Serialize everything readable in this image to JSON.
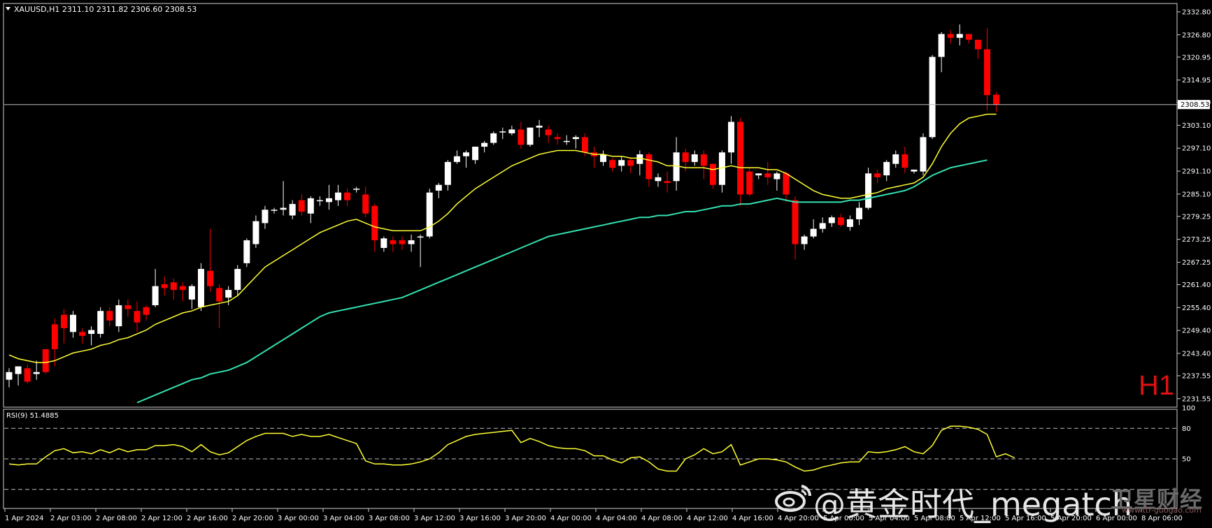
{
  "header": {
    "symbol_line": "XAUUSD,H1  2311.10 2311.82 2306.60 2308.53"
  },
  "timeframe_label": "H1",
  "rsi_header": "RSI(9) 51.4885",
  "current_price_tag": "2308.53",
  "watermark": {
    "text": "@黄金时代_megatch",
    "logo_icon": "weibo-logo-icon",
    "secondary_text": "卫星财经",
    "secondary_sub": "www.ttr-guogao.com"
  },
  "colors": {
    "background": "#000000",
    "bull_candle": "#ffffff",
    "bear_candle": "#ff0000",
    "ma_fast": "#ffff33",
    "ma_slow": "#33e0b0",
    "rsi_line": "#ffff33",
    "timeframe_label": "#dd1111"
  },
  "chart_data": {
    "type": "candlestick",
    "symbol": "XAUUSD",
    "timeframe": "H1",
    "ohlc_header": {
      "open": 2311.1,
      "high": 2311.82,
      "low": 2306.6,
      "close": 2308.53
    },
    "ylim": [
      2229.5,
      2334.8
    ],
    "y_ticks": [
      "2332.80",
      "2326.80",
      "2320.95",
      "2314.95",
      "2309.10",
      "2303.10",
      "2297.10",
      "2291.10",
      "2285.10",
      "2279.25",
      "2273.25",
      "2267.25",
      "2261.40",
      "2255.40",
      "2249.40",
      "2243.40",
      "2237.55",
      "2231.55"
    ],
    "x_tick_labels": [
      "1 Apr 2024",
      "2 Apr 03:00",
      "2 Apr 08:00",
      "2 Apr 12:00",
      "2 Apr 16:00",
      "2 Apr 20:00",
      "3 Apr 00:00",
      "3 Apr 04:00",
      "3 Apr 08:00",
      "3 Apr 12:00",
      "3 Apr 16:00",
      "3 Apr 20:00",
      "4 Apr 00:00",
      "4 Apr 04:00",
      "4 Apr 08:00",
      "4 Apr 12:00",
      "4 Apr 16:00",
      "4 Apr 20:00",
      "5 Apr 00:00",
      "5 Apr 04:00",
      "5 Apr 08:00",
      "5 Apr 12:00",
      "5 Apr 16:00",
      "5 Apr 20:00",
      "6 Apr 00:00",
      "8 Apr 06:00"
    ],
    "candles": [
      [
        2236.5,
        2238.5,
        2234.5,
        2239.5
      ],
      [
        2238.0,
        2240.0,
        2235.0,
        2240.0
      ],
      [
        2239.5,
        2236.0,
        2235.5,
        2240.5
      ],
      [
        2238.0,
        2238.5,
        2236.5,
        2241.5
      ],
      [
        2244.5,
        2238.5,
        2238.0,
        2244.5
      ],
      [
        2251.0,
        2244.5,
        2240.0,
        2252.5
      ],
      [
        2253.5,
        2250.0,
        2246.0,
        2255.0
      ],
      [
        2249.0,
        2253.5,
        2247.5,
        2254.5
      ],
      [
        2249.0,
        2248.0,
        2246.0,
        2250.0
      ],
      [
        2248.5,
        2249.5,
        2245.5,
        2250.5
      ],
      [
        2248.5,
        2254.5,
        2247.5,
        2255.5
      ],
      [
        2254.5,
        2252.0,
        2250.5,
        2255.5
      ],
      [
        2250.5,
        2256.0,
        2249.0,
        2257.5
      ],
      [
        2256.0,
        2255.0,
        2253.0,
        2257.5
      ],
      [
        2254.5,
        2251.5,
        2249.0,
        2257.0
      ],
      [
        2255.5,
        2253.5,
        2252.0,
        2256.0
      ],
      [
        2256.0,
        2261.0,
        2255.5,
        2265.5
      ],
      [
        2261.5,
        2260.5,
        2258.5,
        2263.5
      ],
      [
        2262.0,
        2260.0,
        2257.5,
        2263.0
      ],
      [
        2261.0,
        2260.0,
        2257.0,
        2262.0
      ],
      [
        2257.5,
        2261.0,
        2255.0,
        2261.5
      ],
      [
        2255.5,
        2265.5,
        2254.5,
        2267.0
      ],
      [
        2265.0,
        2261.0,
        2259.5,
        2276.0
      ],
      [
        2260.5,
        2257.0,
        2250.0,
        2261.5
      ],
      [
        2258.0,
        2260.0,
        2256.0,
        2261.0
      ],
      [
        2260.0,
        2265.5,
        2258.5,
        2266.5
      ],
      [
        2267.0,
        2273.0,
        2266.0,
        2273.5
      ],
      [
        2272.0,
        2278.0,
        2271.0,
        2279.5
      ],
      [
        2277.5,
        2281.0,
        2276.0,
        2282.0
      ],
      [
        2281.0,
        2281.0,
        2280.0,
        2281.5
      ],
      [
        2281.0,
        2281.5,
        2279.5,
        2288.5
      ],
      [
        2279.5,
        2282.5,
        2278.5,
        2283.5
      ],
      [
        2283.5,
        2280.5,
        2279.5,
        2285.0
      ],
      [
        2280.0,
        2284.0,
        2277.5,
        2284.5
      ],
      [
        2283.5,
        2283.5,
        2282.0,
        2284.5
      ],
      [
        2283.0,
        2284.0,
        2281.0,
        2287.5
      ],
      [
        2283.5,
        2285.5,
        2282.0,
        2287.5
      ],
      [
        2285.5,
        2283.5,
        2282.0,
        2286.5
      ],
      [
        2286.5,
        2286.5,
        2285.5,
        2287.0
      ],
      [
        2285.0,
        2280.0,
        2279.0,
        2287.0
      ],
      [
        2282.0,
        2273.0,
        2270.0,
        2282.5
      ],
      [
        2271.0,
        2273.5,
        2270.0,
        2274.0
      ],
      [
        2273.0,
        2272.0,
        2270.0,
        2274.0
      ],
      [
        2273.0,
        2272.0,
        2270.5,
        2274.0
      ],
      [
        2272.0,
        2273.0,
        2270.0,
        2274.5
      ],
      [
        2274.0,
        2274.0,
        2266.0,
        2274.5
      ],
      [
        2274.0,
        2285.5,
        2273.5,
        2286.5
      ],
      [
        2286.0,
        2287.5,
        2284.0,
        2288.0
      ],
      [
        2287.5,
        2293.5,
        2286.0,
        2294.0
      ],
      [
        2293.5,
        2295.0,
        2293.0,
        2296.5
      ],
      [
        2295.0,
        2296.0,
        2292.0,
        2296.5
      ],
      [
        2294.0,
        2297.5,
        2293.0,
        2297.5
      ],
      [
        2297.5,
        2298.5,
        2296.0,
        2299.0
      ],
      [
        2298.5,
        2301.0,
        2298.0,
        2301.5
      ],
      [
        2301.5,
        2301.5,
        2299.5,
        2302.5
      ],
      [
        2301.0,
        2302.0,
        2300.5,
        2303.0
      ],
      [
        2302.0,
        2298.0,
        2297.0,
        2304.0
      ],
      [
        2298.0,
        2302.5,
        2297.5,
        2302.5
      ],
      [
        2302.5,
        2303.0,
        2300.0,
        2304.5
      ],
      [
        2302.0,
        2300.5,
        2298.5,
        2303.0
      ],
      [
        2300.0,
        2299.5,
        2298.0,
        2301.0
      ],
      [
        2299.0,
        2299.0,
        2298.0,
        2300.5
      ],
      [
        2299.5,
        2300.0,
        2297.0,
        2300.5
      ],
      [
        2300.0,
        2296.0,
        2295.0,
        2301.0
      ],
      [
        2296.0,
        2295.0,
        2292.0,
        2297.5
      ],
      [
        2293.5,
        2295.5,
        2292.5,
        2296.5
      ],
      [
        2294.0,
        2292.0,
        2291.0,
        2294.5
      ],
      [
        2292.5,
        2294.0,
        2291.0,
        2295.0
      ],
      [
        2294.0,
        2292.5,
        2290.5,
        2294.5
      ],
      [
        2293.0,
        2295.5,
        2290.0,
        2296.5
      ],
      [
        2295.5,
        2289.0,
        2287.0,
        2296.0
      ],
      [
        2288.5,
        2289.5,
        2287.0,
        2290.5
      ],
      [
        2288.5,
        2288.0,
        2285.5,
        2291.0
      ],
      [
        2288.5,
        2296.0,
        2286.0,
        2300.0
      ],
      [
        2296.0,
        2293.5,
        2291.0,
        2297.0
      ],
      [
        2293.5,
        2295.5,
        2292.5,
        2296.5
      ],
      [
        2295.5,
        2292.5,
        2289.0,
        2296.5
      ],
      [
        2293.0,
        2287.5,
        2286.5,
        2293.0
      ],
      [
        2287.5,
        2296.0,
        2285.5,
        2296.5
      ],
      [
        2296.0,
        2304.0,
        2293.0,
        2305.5
      ],
      [
        2304.0,
        2285.0,
        2282.0,
        2305.0
      ],
      [
        2291.0,
        2285.0,
        2284.5,
        2292.0
      ],
      [
        2290.0,
        2290.5,
        2289.0,
        2290.5
      ],
      [
        2290.5,
        2289.5,
        2287.5,
        2293.5
      ],
      [
        2289.0,
        2290.5,
        2286.0,
        2291.0
      ],
      [
        2290.5,
        2285.0,
        2283.0,
        2291.0
      ],
      [
        2283.5,
        2272.0,
        2268.0,
        2284.5
      ],
      [
        2272.0,
        2274.0,
        2270.5,
        2274.5
      ],
      [
        2274.0,
        2276.0,
        2273.5,
        2278.5
      ],
      [
        2276.0,
        2277.5,
        2275.0,
        2279.0
      ],
      [
        2277.5,
        2279.0,
        2276.5,
        2279.5
      ],
      [
        2279.0,
        2277.0,
        2276.5,
        2280.0
      ],
      [
        2276.5,
        2278.5,
        2275.5,
        2279.5
      ],
      [
        2278.5,
        2281.5,
        2277.0,
        2283.0
      ],
      [
        2281.5,
        2290.5,
        2281.0,
        2292.0
      ],
      [
        2290.5,
        2289.5,
        2288.0,
        2291.5
      ],
      [
        2290.0,
        2293.5,
        2288.5,
        2294.0
      ],
      [
        2293.0,
        2295.5,
        2292.0,
        2296.5
      ],
      [
        2295.5,
        2292.0,
        2290.5,
        2297.5
      ],
      [
        2291.0,
        2291.5,
        2290.5,
        2291.5
      ],
      [
        2291.0,
        2300.0,
        2290.0,
        2301.0
      ],
      [
        2300.0,
        2321.0,
        2299.5,
        2321.5
      ],
      [
        2321.0,
        2327.0,
        2317.0,
        2327.5
      ],
      [
        2327.0,
        2326.0,
        2324.5,
        2328.0
      ],
      [
        2326.0,
        2327.0,
        2324.0,
        2329.5
      ],
      [
        2327.0,
        2325.5,
        2324.5,
        2327.0
      ],
      [
        2325.5,
        2323.0,
        2320.5,
        2325.5
      ],
      [
        2323.0,
        2311.0,
        2307.0,
        2328.5
      ],
      [
        2311.1,
        2308.5,
        2306.6,
        2311.8
      ]
    ],
    "ma_fast": [
      2243.0,
      2242.0,
      2241.5,
      2241.0,
      2241.0,
      2241.5,
      2242.5,
      2243.5,
      2244.0,
      2244.5,
      2245.5,
      2246.0,
      2247.0,
      2247.5,
      2248.5,
      2249.5,
      2251.0,
      2252.0,
      2253.0,
      2254.0,
      2254.5,
      2255.5,
      2256.0,
      2256.5,
      2257.0,
      2258.5,
      2261.0,
      2263.5,
      2266.0,
      2267.5,
      2269.0,
      2270.5,
      2272.0,
      2273.5,
      2275.0,
      2276.0,
      2277.0,
      2278.0,
      2278.5,
      2277.5,
      2276.5,
      2276.0,
      2275.5,
      2275.5,
      2275.5,
      2275.5,
      2276.5,
      2278.0,
      2280.0,
      2282.5,
      2284.5,
      2286.5,
      2288.0,
      2289.5,
      2291.0,
      2292.5,
      2293.5,
      2294.5,
      2295.5,
      2296.0,
      2296.5,
      2296.5,
      2296.5,
      2296.0,
      2295.5,
      2295.5,
      2295.0,
      2295.0,
      2294.5,
      2294.5,
      2294.0,
      2293.5,
      2292.5,
      2292.5,
      2292.0,
      2292.0,
      2292.0,
      2291.5,
      2292.0,
      2292.5,
      2292.0,
      2292.0,
      2292.0,
      2291.5,
      2291.5,
      2290.5,
      2289.0,
      2287.5,
      2286.0,
      2285.0,
      2284.5,
      2284.0,
      2284.0,
      2284.5,
      2285.0,
      2285.5,
      2286.5,
      2287.0,
      2287.5,
      2288.0,
      2289.5,
      2293.0,
      2297.5,
      2301.0,
      2303.5,
      2305.0,
      2305.5,
      2306.0,
      2306.0
    ],
    "ma_slow_start_index": 14,
    "ma_slow": [
      2230.5,
      2231.5,
      2232.5,
      2233.5,
      2234.5,
      2235.5,
      2236.5,
      2237.0,
      2238.0,
      2238.5,
      2239.0,
      2240.0,
      2241.0,
      2242.5,
      2244.0,
      2245.5,
      2247.0,
      2248.5,
      2250.0,
      2251.5,
      2253.0,
      2254.0,
      2254.5,
      2255.0,
      2255.5,
      2256.0,
      2256.5,
      2257.0,
      2257.5,
      2258.0,
      2259.0,
      2260.0,
      2261.0,
      2262.0,
      2263.0,
      2264.0,
      2265.0,
      2266.0,
      2267.0,
      2268.0,
      2269.0,
      2270.0,
      2271.0,
      2272.0,
      2273.0,
      2274.0,
      2274.5,
      2275.0,
      2275.5,
      2276.0,
      2276.5,
      2277.0,
      2277.5,
      2278.0,
      2278.5,
      2279.0,
      2279.0,
      2279.5,
      2279.5,
      2280.0,
      2280.5,
      2280.5,
      2281.0,
      2281.5,
      2282.0,
      2282.0,
      2282.5,
      2282.5,
      2283.0,
      2283.5,
      2284.0,
      2283.5,
      2283.0,
      2283.0,
      2283.0,
      2283.0,
      2283.0,
      2283.0,
      2283.5,
      2283.5,
      2284.0,
      2284.5,
      2285.0,
      2285.5,
      2286.0,
      2287.0,
      2288.5,
      2290.0,
      2291.0,
      2292.0,
      2292.5,
      2293.0,
      2293.5,
      2294.0
    ],
    "rsi": {
      "period": 9,
      "value": 51.4885,
      "levels": [
        80,
        50,
        20
      ],
      "ylim": [
        2,
        98
      ],
      "y_ticks": [
        "100",
        "80",
        "50"
      ],
      "values": [
        45,
        44,
        45,
        45,
        52,
        58,
        60,
        56,
        57,
        55,
        59,
        56,
        60,
        57,
        59,
        59,
        63,
        63,
        64,
        62,
        57,
        64,
        57,
        54,
        56,
        62,
        68,
        72,
        75,
        75,
        75,
        72,
        74,
        72,
        72,
        74,
        71,
        68,
        65,
        48,
        45,
        45,
        44,
        44,
        45,
        47,
        50,
        56,
        64,
        68,
        72,
        74,
        75,
        76,
        77,
        78,
        66,
        70,
        67,
        63,
        61,
        60,
        60,
        58,
        53,
        53,
        49,
        46,
        51,
        52,
        47,
        40,
        38,
        38,
        50,
        54,
        60,
        55,
        57,
        64,
        44,
        47,
        50,
        50,
        49,
        47,
        42,
        38,
        39,
        42,
        44,
        46,
        47,
        47,
        57,
        56,
        57,
        59,
        62,
        57,
        55,
        63,
        78,
        82,
        82,
        81,
        79,
        74,
        52,
        55,
        51
      ]
    }
  }
}
